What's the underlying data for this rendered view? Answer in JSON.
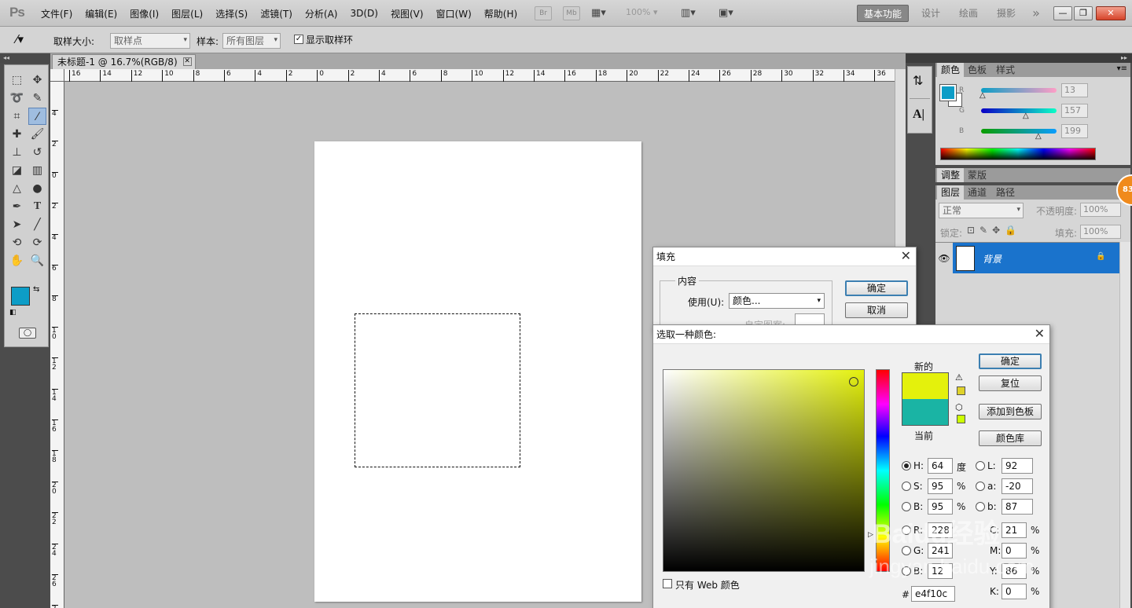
{
  "app": {
    "logo": "Ps",
    "menus": [
      "文件(F)",
      "编辑(E)",
      "图像(I)",
      "图层(L)",
      "选择(S)",
      "滤镜(T)",
      "分析(A)",
      "3D(D)",
      "视图(V)",
      "窗口(W)",
      "帮助(H)"
    ],
    "bridge_label": "Br",
    "minibridge_label": "Mb",
    "zoom": "100%",
    "workspaces": [
      "基本功能",
      "设计",
      "绘画",
      "摄影"
    ],
    "ws_more": "»"
  },
  "options": {
    "sample_size_label": "取样大小:",
    "sample_size_value": "取样点",
    "sample_label": "样本:",
    "sample_value": "所有图层",
    "show_ring_label": "显示取样环"
  },
  "document": {
    "tab_title": "未标题-1 @ 16.7%(RGB/8)",
    "ruler_top": [
      "16",
      "14",
      "12",
      "10",
      "8",
      "6",
      "4",
      "2",
      "0",
      "2",
      "4",
      "6",
      "8",
      "10",
      "12",
      "14",
      "16",
      "18",
      "20",
      "22",
      "24",
      "26",
      "28",
      "30",
      "32",
      "34",
      "36"
    ],
    "ruler_left": [
      "4",
      "2",
      "0",
      "2",
      "4",
      "6",
      "8",
      "10",
      "12",
      "14",
      "16",
      "18",
      "20",
      "22",
      "24",
      "26",
      "28"
    ]
  },
  "colors": {
    "foreground": "#0d9dc7",
    "new_color": "#e4f10c",
    "current_color": "#1ab4a4",
    "accent_blue": "#1a73cc"
  },
  "color_panel": {
    "tabs": [
      "颜色",
      "色板",
      "样式"
    ],
    "r_label": "R",
    "r_value": "13",
    "g_label": "G",
    "g_value": "157",
    "b_label": "B",
    "b_value": "199"
  },
  "adjust_panel": {
    "tabs": [
      "调整",
      "蒙版"
    ]
  },
  "layers_panel": {
    "tabs": [
      "图层",
      "通道",
      "路径"
    ],
    "blend_mode": "正常",
    "opacity_label": "不透明度:",
    "opacity_value": "100%",
    "lock_label": "锁定:",
    "fill_label": "填充:",
    "fill_value": "100%",
    "layer_name": "背景",
    "badge": "83"
  },
  "fill_dialog": {
    "title": "填充",
    "group_label": "内容",
    "use_label": "使用(U):",
    "use_value": "颜色...",
    "custom_pattern_label": "自定图案:",
    "ok": "确定",
    "cancel": "取消"
  },
  "picker": {
    "title": "选取一种颜色:",
    "new_label": "新的",
    "current_label": "当前",
    "ok": "确定",
    "reset": "复位",
    "add_swatch": "添加到色板",
    "libraries": "颜色库",
    "h_label": "H:",
    "h_value": "64",
    "h_unit": "度",
    "s_label": "S:",
    "s_value": "95",
    "s_unit": "%",
    "b_label": "B:",
    "b_value": "95",
    "b_unit": "%",
    "r_label": "R:",
    "r_value": "228",
    "g_label": "G:",
    "g_value": "241",
    "bb_label": "B:",
    "bb_value": "12",
    "l_label": "L:",
    "l_value": "92",
    "a_label": "a:",
    "a_value": "-20",
    "lb_label": "b:",
    "lb_value": "87",
    "c_label": "C:",
    "c_value": "21",
    "c_unit": "%",
    "m_label": "M:",
    "m_value": "0",
    "m_unit": "%",
    "y_label": "Y:",
    "y_value": "86",
    "y_unit": "%",
    "k_label": "K:",
    "k_value": "0",
    "k_unit": "%",
    "hex_label": "#",
    "hex_value": "e4f10c",
    "web_only_label": "只有 Web 颜色"
  },
  "watermark": {
    "text1": "Baidu经验",
    "text2": "jingyan.baidu.com"
  }
}
